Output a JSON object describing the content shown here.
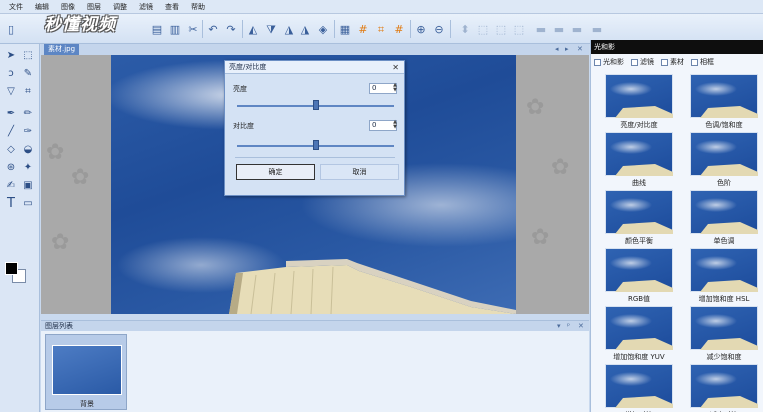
{
  "menu": [
    "文件",
    "编辑",
    "图像",
    "图层",
    "调整",
    "滤镜",
    "查看",
    "帮助"
  ],
  "logo_text": "秒懂视频",
  "document": {
    "tab_label": "素材.jpg"
  },
  "dialog": {
    "title": "亮度/对比度",
    "brightness_label": "亮度",
    "brightness_value": "0",
    "brightness_level": 0.5,
    "contrast_label": "对比度",
    "contrast_value": "0",
    "contrast_level": 0.5,
    "ok_label": "确定",
    "cancel_label": "取消"
  },
  "layers": {
    "title": "图层列表",
    "items": [
      {
        "label": "背景"
      }
    ]
  },
  "right_panel": {
    "title": "光和影",
    "tabs": [
      "光和影",
      "滤镜",
      "素材",
      "相框"
    ],
    "effects": [
      "亮度/对比度",
      "色调/饱和度",
      "曲线",
      "色阶",
      "颜色平衡",
      "单色调",
      "RGB值",
      "增加饱和度 HSL",
      "增加饱和度 YUV",
      "减少饱和度",
      "增加对比",
      "减少对比"
    ]
  },
  "colors": {
    "accent": "#5d86c4",
    "foreground": "#000000",
    "background": "#ffffff",
    "panel_title_bg": "#0e0e0e"
  }
}
